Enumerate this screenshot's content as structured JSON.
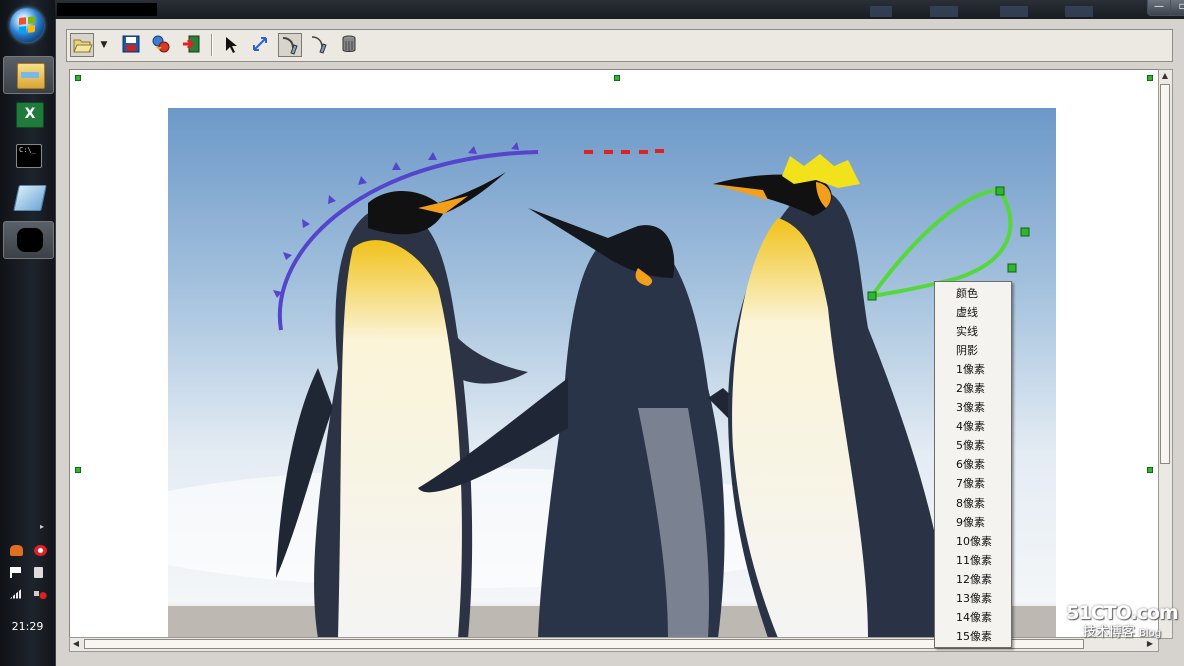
{
  "taskbar": {
    "items": [
      {
        "name": "start-orb"
      },
      {
        "name": "windows-explorer"
      },
      {
        "name": "excel"
      },
      {
        "name": "command-prompt"
      },
      {
        "name": "app-icon"
      },
      {
        "name": "redacted-app",
        "active": true
      }
    ],
    "cmd_text": "C:\\_",
    "tray_arrow": "▸",
    "clock": "21:29"
  },
  "window": {
    "title": "",
    "controls": [
      "—",
      "▫",
      "✕"
    ]
  },
  "toolbar": {
    "buttons": [
      {
        "id": "open",
        "icon": "folder-open-icon"
      },
      {
        "id": "save",
        "icon": "save-icon"
      },
      {
        "id": "filter",
        "icon": "filter-icon"
      },
      {
        "id": "exit",
        "icon": "exit-icon"
      },
      {
        "id": "select",
        "icon": "arrow-cursor-icon"
      },
      {
        "id": "resize",
        "icon": "resize-icon"
      },
      {
        "id": "pen-curve",
        "icon": "pen-curve-icon",
        "pressed": true
      },
      {
        "id": "pen",
        "icon": "pen-icon"
      },
      {
        "id": "trash",
        "icon": "trash-can-icon"
      }
    ]
  },
  "context_menu": {
    "items": [
      "颜色",
      "虚线",
      "实线",
      "阴影",
      "1像素",
      "2像素",
      "3像素",
      "4像素",
      "5像素",
      "6像素",
      "7像素",
      "8像素",
      "9像素",
      "10像素",
      "11像素",
      "12像素",
      "13像素",
      "14像素",
      "15像素"
    ]
  },
  "annotations": {
    "arc_color": "#5544cc",
    "dash_color": "#dd2222",
    "star_color": "#f2e21c",
    "curve_color": "#55d83b",
    "handle_color": "#2fb52f"
  },
  "watermark": {
    "main": "51CTO.com",
    "sub": "技术博客",
    "tag": "Blog"
  }
}
